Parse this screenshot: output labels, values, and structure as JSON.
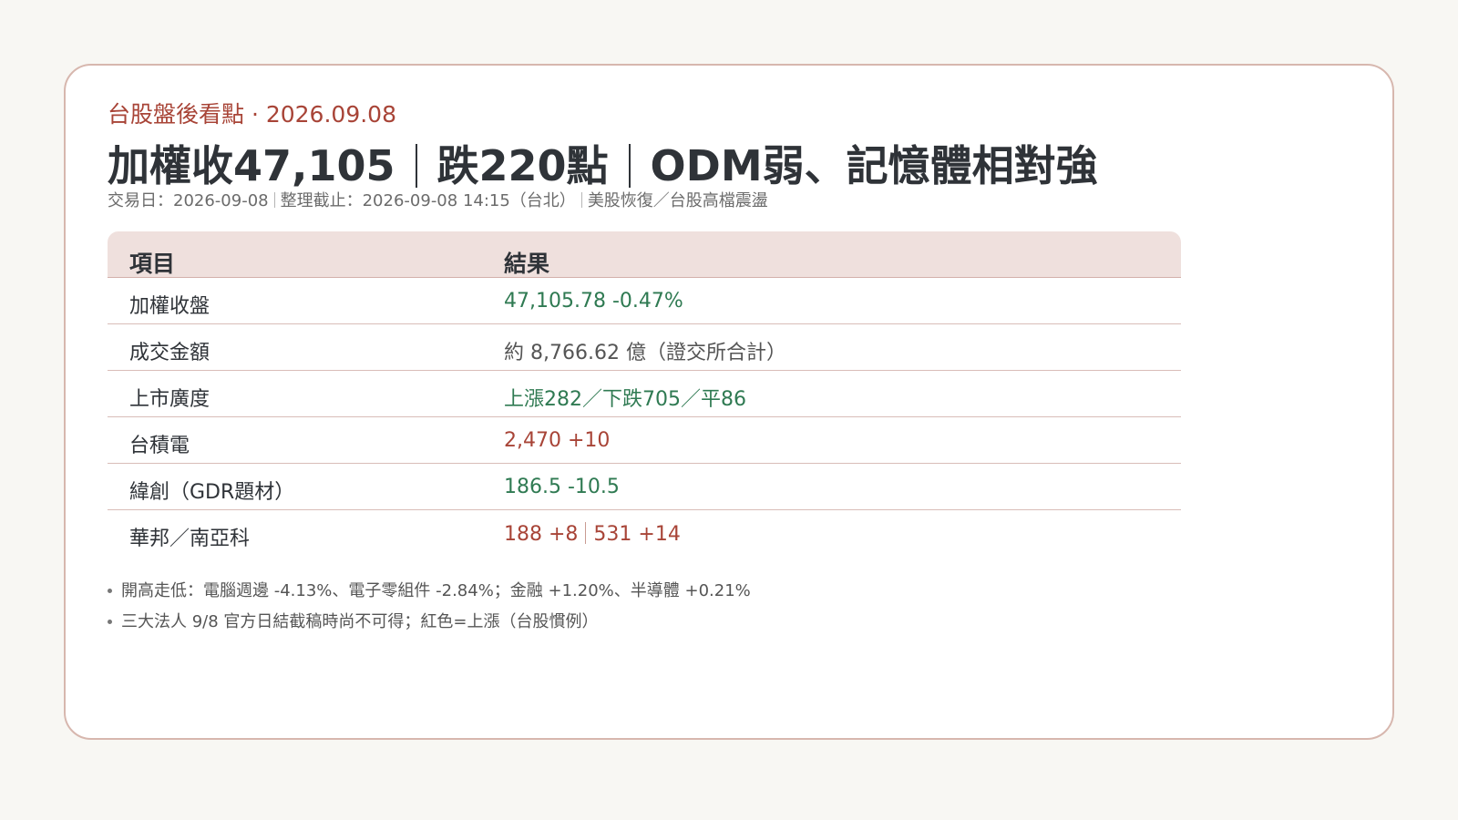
{
  "header": {
    "eyebrow": "台股盤後看點 · 2026.09.08",
    "headline_parts": [
      "加權收47,105",
      "跌220點",
      "ODM弱、記憶體相對強"
    ],
    "meta_parts": [
      "交易日：2026-09-08",
      "整理截止：2026-09-08 14:15（台北）",
      "美股恢復／台股高檔震盪"
    ]
  },
  "table": {
    "headers": [
      "項目",
      "結果"
    ],
    "rows": [
      {
        "label": "加權收盤",
        "value": "47,105.78  -0.47%",
        "tone": "down"
      },
      {
        "label": "成交金額",
        "value": "約 8,766.62 億（證交所合計）",
        "tone": "neutral"
      },
      {
        "label": "上市廣度",
        "value": "上漲282／下跌705／平86",
        "tone": "down"
      },
      {
        "label": "台積電",
        "value": "2,470  +10",
        "tone": "up"
      },
      {
        "label": "緯創（GDR題材）",
        "value": "186.5  -10.5",
        "tone": "down"
      },
      {
        "label": "華邦／南亞科",
        "value_parts": [
          "188 +8",
          "531 +14"
        ],
        "tone": "up"
      }
    ]
  },
  "notes": [
    "開高走低：電腦週邊 -4.13%、電子零組件 -2.84%；金融 +1.20%、半導體 +0.21%",
    "三大法人 9/8 官方日結截稿時尚不可得；紅色=上漲（台股慣例）"
  ],
  "colors": {
    "up": "#a84437",
    "down": "#2f7a52",
    "accent": "#a84437",
    "header_bg": "#efe0dd",
    "card_border": "#d7b7ae"
  }
}
